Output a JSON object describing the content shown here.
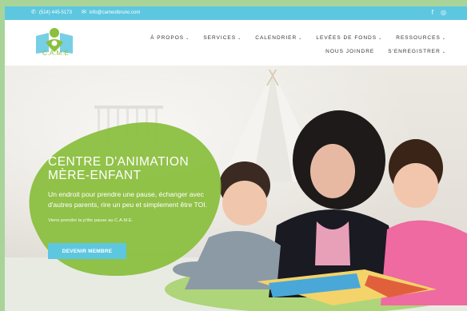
{
  "topbar": {
    "phone": "(514) 445-5173",
    "email": "info@camestbruno.com",
    "social": [
      "f",
      "◎"
    ]
  },
  "logo": {
    "text": "C.A.M.E"
  },
  "nav": {
    "row1": [
      {
        "label": "À PROPOS",
        "dropdown": true
      },
      {
        "label": "SERVICES",
        "dropdown": true
      },
      {
        "label": "CALENDRIER",
        "dropdown": true
      },
      {
        "label": "LEVÉES DE FONDS",
        "dropdown": true
      },
      {
        "label": "RESSOURCES",
        "dropdown": true
      }
    ],
    "row2": [
      {
        "label": "NOUS JOINDRE",
        "dropdown": false
      },
      {
        "label": "S'ENREGISTRER",
        "dropdown": true
      }
    ]
  },
  "hero": {
    "title_line1": "CENTRE D'ANIMATION",
    "title_line2": "MÈRE-ENFANT",
    "subtitle": "Un endroit pour prendre une pause, échanger avec d'autres parents, rire un peu et simplement être TOI.",
    "small_text": "Viens prendre ta p'tite pause au C.A.M.E.",
    "cta_label": "DEVENIR MEMBRE"
  },
  "colors": {
    "topbar": "#5ec7e0",
    "accent_green": "#8bbf3f",
    "button": "#5ec7e0"
  }
}
